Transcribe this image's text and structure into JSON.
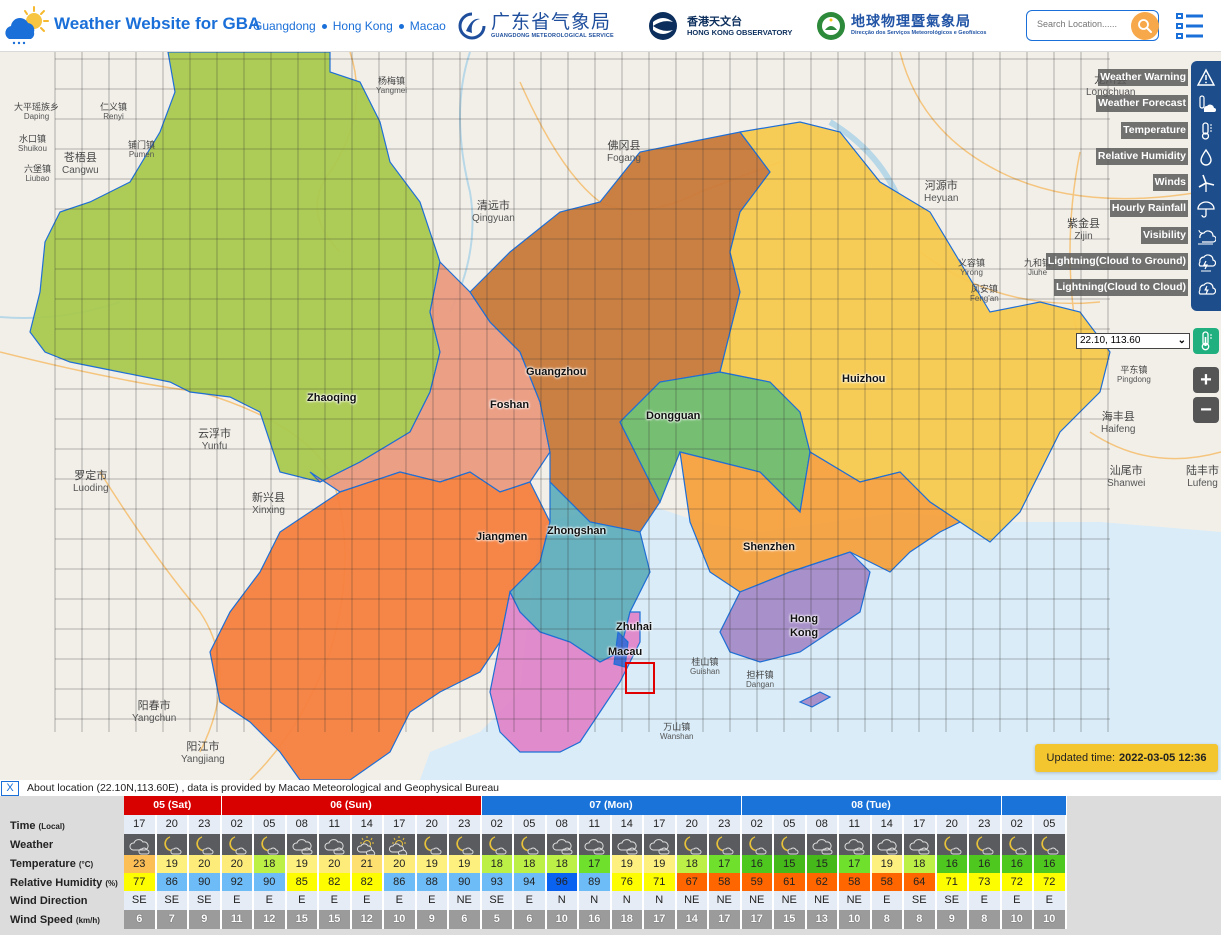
{
  "header": {
    "title": "Weather Website for GBA",
    "regions": [
      "Guangdong",
      "Hong Kong",
      "Macao"
    ],
    "partners": [
      {
        "name_cn": "广东省气象局",
        "name_en": "GUANGDONG METEOROLOGICAL SERVICE"
      },
      {
        "name_cn": "香港天文台",
        "name_en": "HONG KONG OBSERVATORY"
      },
      {
        "name_cn": "地球物理暨氣象局",
        "name_en": "Direcção dos Serviços Meteorológicos e Geofísicos"
      }
    ],
    "search_placeholder": "Search Location......"
  },
  "map": {
    "cities": [
      "Zhaoqing",
      "Guangzhou",
      "Foshan",
      "Dongguan",
      "Huizhou",
      "Jiangmen",
      "Zhongshan",
      "Shenzhen",
      "Zhuhai",
      "Macau",
      "Hong Kong"
    ],
    "region_colors": {
      "Zhaoqing": "#a9c94f",
      "Guangzhou": "#c8793a",
      "Foshan": "#ea9a80",
      "Dongguan": "#6fba6c",
      "Huizhou": "#f7c94e",
      "Jiangmen": "#f5803e",
      "Zhongshan": "#62aebc",
      "Shenzhen": "#f5a13e",
      "Zhuhai": "#df86c9",
      "Hong Kong": "#a58bc7",
      "Macau": "#3c6bd6"
    },
    "towns": [
      {
        "cn": "大平瑶族乡",
        "en": "Daping"
      },
      {
        "cn": "仁义镇",
        "en": "Renyi"
      },
      {
        "cn": "水口镇",
        "en": "Shuikou"
      },
      {
        "cn": "苍梧县",
        "en": "Cangwu"
      },
      {
        "cn": "六堡镇",
        "en": "Liubao"
      },
      {
        "cn": "铺门镇",
        "en": "Pumen"
      },
      {
        "cn": "杨梅镇",
        "en": "Yangmei"
      },
      {
        "cn": "清远市",
        "en": "Qingyuan"
      },
      {
        "cn": "佛冈县",
        "en": "Fogang"
      },
      {
        "cn": "河源市",
        "en": "Heyuan"
      },
      {
        "cn": "紫金县",
        "en": "Zijin"
      },
      {
        "cn": "龙川县",
        "en": "Longchuan"
      },
      {
        "cn": "云浮市",
        "en": "Yunfu"
      },
      {
        "cn": "罗定市",
        "en": "Luoding"
      },
      {
        "cn": "新兴县",
        "en": "Xinxing"
      },
      {
        "cn": "阳春市",
        "en": "Yangchun"
      },
      {
        "cn": "阳江市",
        "en": "Yangjiang"
      },
      {
        "cn": "海丰县",
        "en": "Haifeng"
      },
      {
        "cn": "汕尾市",
        "en": "Shanwei"
      },
      {
        "cn": "陆丰市",
        "en": "Lufeng"
      },
      {
        "cn": "平东镇",
        "en": "Pingdong"
      },
      {
        "cn": "桂山镇",
        "en": "Guishan"
      },
      {
        "cn": "担杆镇",
        "en": "Dangan"
      },
      {
        "cn": "万山镇",
        "en": "Wanshan"
      },
      {
        "cn": "义容镇",
        "en": "Yirong"
      },
      {
        "cn": "九和镇",
        "en": "Jiuhe"
      },
      {
        "cn": "凤安镇",
        "en": "Feng'an"
      }
    ]
  },
  "toolbar": {
    "items": [
      {
        "label": "Weather Warning",
        "icon": "warning-icon"
      },
      {
        "label": "Weather Forecast",
        "icon": "forecast-icon"
      },
      {
        "label": "Temperature",
        "icon": "thermometer-icon"
      },
      {
        "label": "Relative Humidity",
        "icon": "droplet-icon"
      },
      {
        "label": "Winds",
        "icon": "windmill-icon"
      },
      {
        "label": "Hourly Rainfall",
        "icon": "umbrella-icon"
      },
      {
        "label": "Visibility",
        "icon": "fog-icon"
      },
      {
        "label": "Lightning(Cloud to Ground)",
        "icon": "lightning-ground-icon"
      },
      {
        "label": "Lightning(Cloud to Cloud)",
        "icon": "lightning-cloud-icon"
      }
    ],
    "location_select": "22.10, 113.60",
    "zoom_in": "+",
    "zoom_out": "−"
  },
  "updated": {
    "label": "Updated time:",
    "value": "2022-03-05 12:36"
  },
  "about": {
    "close": "X",
    "text": "About location (22.10N,113.60E) , data is provided by Macao Meteorological and Geophysical Bureau"
  },
  "forecast": {
    "row_labels": [
      {
        "name": "Time",
        "unit": "(Local)"
      },
      {
        "name": "Weather",
        "unit": ""
      },
      {
        "name": "Temperature",
        "unit": "(°C)"
      },
      {
        "name": "Relative Humidity",
        "unit": "(%)"
      },
      {
        "name": "Wind Direction",
        "unit": ""
      },
      {
        "name": "Wind Speed",
        "unit": "(km/h)"
      }
    ],
    "days": [
      {
        "label": "05 (Sat)",
        "count": 3,
        "color": "#d90000"
      },
      {
        "label": "06 (Sun)",
        "count": 8,
        "color": "#d90000"
      },
      {
        "label": "07 (Mon)",
        "count": 8,
        "color": "#1a73d9"
      },
      {
        "label": "08 (Tue)",
        "count": 8,
        "color": "#1a73d9"
      },
      {
        "label": "",
        "count": 2,
        "color": "#1a73d9"
      }
    ],
    "times": [
      "17",
      "20",
      "23",
      "02",
      "05",
      "08",
      "11",
      "14",
      "17",
      "20",
      "23",
      "02",
      "05",
      "08",
      "11",
      "14",
      "17",
      "20",
      "23",
      "02",
      "05",
      "08",
      "11",
      "14",
      "17",
      "20",
      "23",
      "02",
      "05"
    ],
    "weather": [
      "cloudy",
      "night-cloudy",
      "night-cloudy",
      "night-cloudy",
      "night-cloudy",
      "cloudy",
      "cloudy",
      "sun-cloudy",
      "sun-cloudy",
      "night-cloudy",
      "night-cloudy",
      "night-cloudy",
      "night-cloudy",
      "cloudy",
      "cloudy",
      "cloudy",
      "cloudy",
      "night-cloudy",
      "night-cloudy",
      "night-cloudy",
      "night-cloudy",
      "cloudy",
      "cloudy",
      "cloudy",
      "cloudy",
      "night-cloudy",
      "night-cloudy",
      "night-cloudy",
      "night-cloudy"
    ],
    "temperature": [
      23,
      19,
      20,
      20,
      18,
      19,
      20,
      21,
      20,
      19,
      19,
      18,
      18,
      18,
      17,
      19,
      19,
      18,
      17,
      16,
      15,
      15,
      17,
      19,
      18,
      16,
      16,
      16,
      16
    ],
    "humidity": [
      77,
      86,
      90,
      92,
      90,
      85,
      82,
      82,
      86,
      88,
      90,
      93,
      94,
      96,
      89,
      76,
      71,
      67,
      58,
      59,
      61,
      62,
      58,
      58,
      64,
      71,
      73,
      72,
      72
    ],
    "wind_direction": [
      "SE",
      "SE",
      "SE",
      "E",
      "E",
      "E",
      "E",
      "E",
      "E",
      "E",
      "NE",
      "SE",
      "E",
      "N",
      "N",
      "N",
      "N",
      "NE",
      "NE",
      "NE",
      "NE",
      "NE",
      "NE",
      "E",
      "SE",
      "SE",
      "E",
      "E",
      "E"
    ],
    "wind_speed": [
      6,
      7,
      9,
      11,
      12,
      15,
      15,
      12,
      10,
      9,
      6,
      5,
      6,
      10,
      16,
      18,
      17,
      14,
      17,
      17,
      15,
      13,
      10,
      8,
      8,
      9,
      8,
      10,
      10
    ],
    "temp_colors": {
      "23": "#fbbf55",
      "21": "#fde070",
      "20": "#fdeb7a",
      "19": "#fdf07e",
      "18": "#bdf046",
      "17": "#6fe02c",
      "16": "#4ec81e",
      "15": "#45b81a"
    },
    "humidity_colors": {
      "blue_dark": "#0a62f0",
      "blue": "#6ebcf7",
      "yellow": "#fdfd00",
      "orange": "#ff6600"
    }
  }
}
